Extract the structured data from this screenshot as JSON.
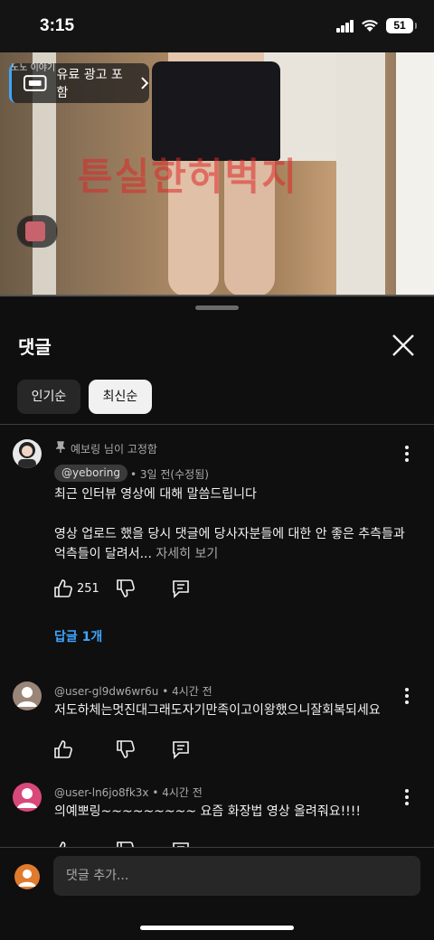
{
  "status_bar": {
    "time": "3:15",
    "battery": "51"
  },
  "video": {
    "ad_badge_label": "유료 광고 포함",
    "watermark": "노노 이야기",
    "overlay_text": "튼실한허벅지"
  },
  "comments_sheet": {
    "title": "댓글",
    "sort_chips": [
      "인기순",
      "최신순"
    ],
    "selected_sort": "최신순"
  },
  "comments": [
    {
      "pinned_label": "예보링 님이 고정함",
      "author": "@yeboring",
      "time": "3일 전(수정됨)",
      "line1": "최근 인터뷰 영상에 대해 말씀드립니다",
      "line2": "영상 업로드 했을 당시 댓글에 당사자분들에 대한 안 좋은 추측들과",
      "line3": "억측들이 달려서...",
      "see_more": "자세히 보기",
      "likes": "251",
      "replies_label": "답글 1개"
    },
    {
      "author": "@user-gl9dw6wr6u",
      "time": "4시간 전",
      "text": "저도하체는멋진대그래도자기만족이고이왕했으니잘회복되세요"
    },
    {
      "author": "@user-ln6jo8fk3x",
      "time": "4시간 전",
      "text": "의예뽀링~~~~~~~~~ 요즘 화장법 영상 올려줘요!!!!"
    }
  ],
  "composer": {
    "placeholder": "댓글 추가..."
  },
  "colors": {
    "accent_blue": "#3ea6ff",
    "background": "#0f0f0f",
    "chip_selected": "#f1f1f1"
  }
}
